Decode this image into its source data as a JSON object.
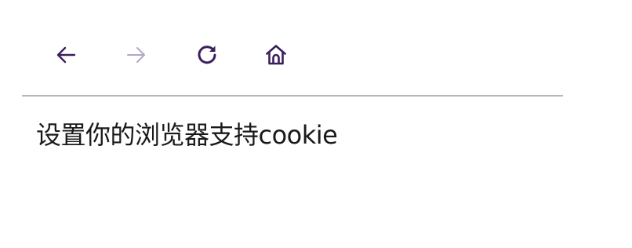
{
  "toolbar": {
    "buttons": [
      {
        "id": "back",
        "icon": "arrow-left-icon",
        "enabled": true
      },
      {
        "id": "forward",
        "icon": "arrow-right-icon",
        "enabled": false
      },
      {
        "id": "reload",
        "icon": "reload-icon",
        "enabled": true
      },
      {
        "id": "home",
        "icon": "home-icon",
        "enabled": true
      }
    ]
  },
  "colors": {
    "icon_active": "#3b1f5e",
    "icon_disabled": "#b3a6c6",
    "divider": "#b8b5bd",
    "text": "#1a1a1a"
  },
  "main": {
    "message": "设置你的浏览器支持cookie"
  }
}
